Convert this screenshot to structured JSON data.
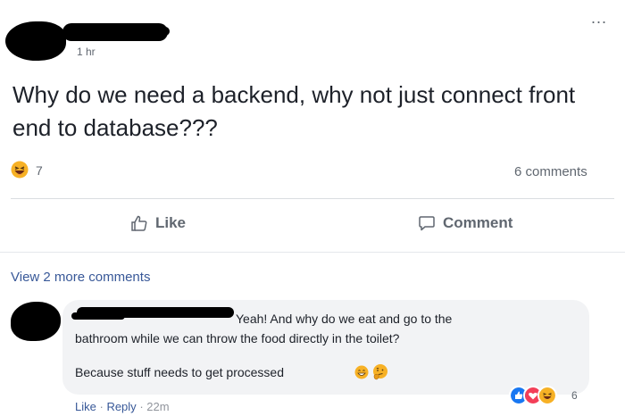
{
  "post": {
    "timestamp": "1 hr",
    "more_menu_label": "...",
    "text": "Why do we need a backend, why not just connect front end to database???",
    "reaction_icon": "haha-emoji-icon",
    "reaction_count": "7",
    "comments_count": "6 comments"
  },
  "actions": {
    "like_label": "Like",
    "comment_label": "Comment"
  },
  "comments": {
    "view_more_label": "View 2 more comments",
    "item": {
      "line1": "Yeah! And why do we eat and go to the",
      "line2": "bathroom while we can throw the food directly in the toilet?",
      "line3": "Because stuff needs to get processed",
      "like_label": "Like",
      "separator": "·",
      "reply_label": "Reply",
      "time": "22m",
      "reactions": [
        "like-icon",
        "love-icon",
        "haha-icon"
      ],
      "reaction_count": "6"
    }
  },
  "colors": {
    "link": "#385898",
    "secondary_text": "#606770",
    "bubble": "#f2f3f5",
    "like_blue": "#1877f2",
    "love_red": "#f33e58",
    "haha_yellow": "#f7b125"
  }
}
